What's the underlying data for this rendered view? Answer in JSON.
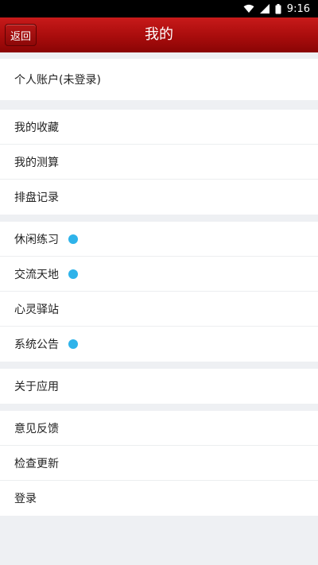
{
  "status_bar": {
    "time": "9:16",
    "icons": [
      "wifi-icon",
      "signal-icon",
      "battery-icon"
    ]
  },
  "header": {
    "back_label": "返回",
    "title": "我的"
  },
  "colors": {
    "header_red": "#a80c0c",
    "badge_blue": "#2eb3ea",
    "background": "#eef0f3"
  },
  "menu": {
    "account": {
      "label": "个人账户(未登录)"
    },
    "favorites": {
      "label": "我的收藏"
    },
    "my_readings": {
      "label": "我的测算"
    },
    "chart_records": {
      "label": "排盘记录"
    },
    "leisure_practice": {
      "label": "休闲练习",
      "badge": true
    },
    "community": {
      "label": "交流天地",
      "badge": true
    },
    "soul_station": {
      "label": "心灵驿站"
    },
    "announcements": {
      "label": "系统公告",
      "badge": true
    },
    "about_app": {
      "label": "关于应用"
    },
    "feedback": {
      "label": "意见反馈"
    },
    "check_update": {
      "label": "检查更新"
    },
    "login": {
      "label": "登录"
    }
  }
}
